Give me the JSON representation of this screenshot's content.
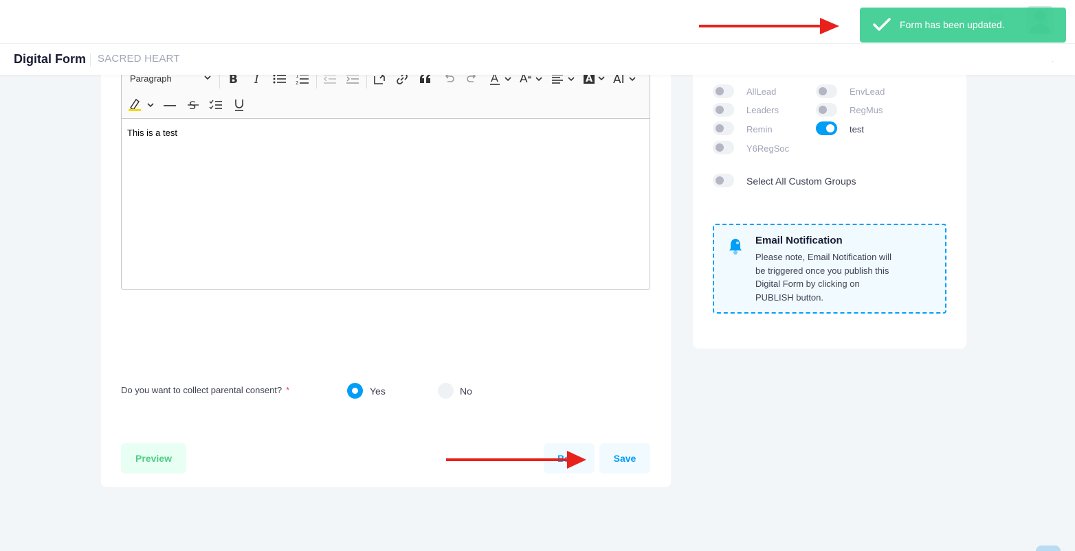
{
  "header": {
    "title": "Digital Form",
    "subtitle": "SACRED HEART"
  },
  "toast": {
    "message": "Form has been updated.",
    "color": "#3dce92"
  },
  "editor": {
    "block_format": "Paragraph",
    "content": "This is a test"
  },
  "consent": {
    "question": "Do you want to collect parental consent?",
    "required_mark": "*",
    "options": [
      {
        "label": "Yes",
        "selected": true
      },
      {
        "label": "No",
        "selected": false
      }
    ]
  },
  "buttons": {
    "preview": "Preview",
    "back": "Ba",
    "save": "Save"
  },
  "groups": [
    {
      "label": "AllLead",
      "on": false
    },
    {
      "label": "EnvLead",
      "on": false
    },
    {
      "label": "Leaders",
      "on": false
    },
    {
      "label": "RegMus",
      "on": false
    },
    {
      "label": "Remin",
      "on": false
    },
    {
      "label": "test",
      "on": true
    },
    {
      "label": "Y6RegSoc",
      "on": false
    }
  ],
  "select_all": {
    "label": "Select All Custom Groups",
    "on": false
  },
  "notice": {
    "title": "Email Notification",
    "body": "Please note, Email Notification will be triggered once you publish this Digital Form by clicking on PUBLISH button."
  },
  "colors": {
    "primary": "#009ef7",
    "success": "#50cd89",
    "annotation_arrow": "#e8211b"
  }
}
